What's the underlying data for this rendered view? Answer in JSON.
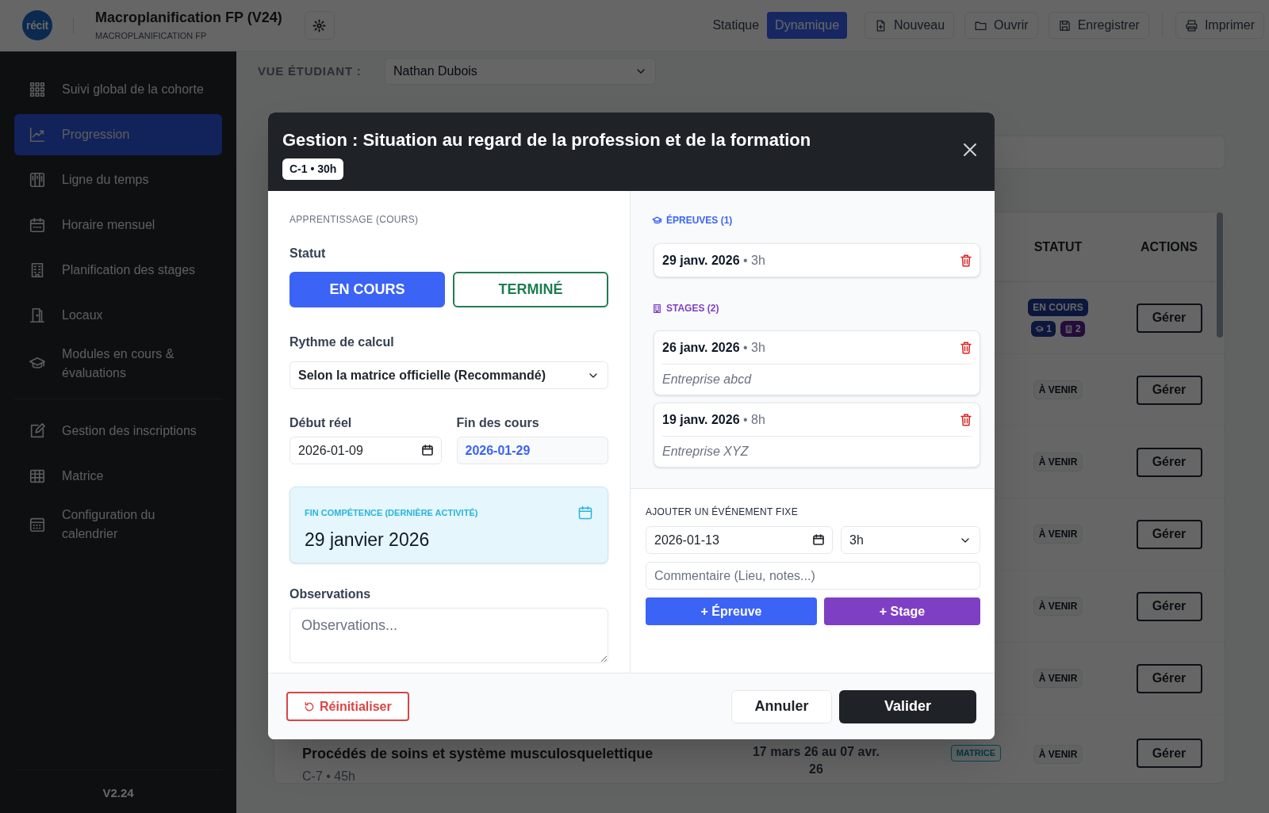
{
  "app_header": {
    "logo_text": "récit",
    "title": "Macroplanification FP (V24)",
    "subtitle": "MACROPLANIFICATION FP",
    "view_modes": [
      {
        "label": "Statique",
        "selected": false
      },
      {
        "label": "Dynamique",
        "selected": true
      }
    ],
    "actions": [
      {
        "label": "Nouveau",
        "kind": "new"
      },
      {
        "label": "Ouvrir",
        "kind": "open"
      },
      {
        "label": "Enregistrer",
        "kind": "save"
      }
    ],
    "print_action": {
      "label": "Imprimer",
      "kind": "print"
    }
  },
  "sidebar": {
    "sections": [
      {
        "items": [
          {
            "label": "Suivi global de la cohorte",
            "kind": "grid",
            "selected": false
          },
          {
            "label": "Progression",
            "kind": "chart",
            "selected": true
          },
          {
            "label": "Ligne du temps",
            "kind": "timeline",
            "selected": false
          },
          {
            "label": "Horaire mensuel",
            "kind": "calendar",
            "selected": false
          },
          {
            "label": "Planification des stages",
            "kind": "building",
            "selected": false
          },
          {
            "label": "Locaux",
            "kind": "door",
            "selected": false
          },
          {
            "label": "Modules en cours & évaluations",
            "kind": "cap",
            "selected": false
          }
        ]
      },
      {
        "items": [
          {
            "label": "Gestion des inscriptions",
            "kind": "edit",
            "selected": false
          },
          {
            "label": "Matrice",
            "kind": "table",
            "selected": false
          },
          {
            "label": "Configuration du calendrier",
            "kind": "calgrid",
            "selected": false
          }
        ]
      }
    ],
    "version": "V2.24"
  },
  "student_view": {
    "label": "VUE ÉTUDIANT :",
    "value": "Nathan Dubois"
  },
  "table": {
    "columns": [
      {
        "label": "STATUT"
      },
      {
        "label": "ACTIONS"
      }
    ],
    "rows": [
      {
        "status": "EN COURS",
        "kind": "current",
        "counts": [
          {
            "kind": "exam",
            "text": "1"
          },
          {
            "kind": "internship",
            "text": "2"
          }
        ],
        "action": "Gérer"
      },
      {
        "status": "À VENIR",
        "kind": "upcoming",
        "action": "Gérer"
      },
      {
        "status": "À VENIR",
        "kind": "upcoming",
        "action": "Gérer"
      },
      {
        "status": "À VENIR",
        "kind": "upcoming",
        "action": "Gérer"
      },
      {
        "status": "À VENIR",
        "kind": "upcoming",
        "action": "Gérer"
      },
      {
        "status": "À VENIR",
        "kind": "upcoming",
        "action": "Gérer"
      },
      {
        "title": "Procédés de soins et système musculosquelettique",
        "code": "C-7 • 45h",
        "dates": "17 mars 26 au 07 avr. 26",
        "source": "MATRICE",
        "status": "À VENIR",
        "kind": "upcoming",
        "action": "Gérer"
      }
    ]
  },
  "modal": {
    "title": "Gestion : Situation au regard de la profession et de la formation",
    "badge": "C-1 • 30h",
    "section_label": "APPRENTISSAGE (COURS)",
    "status": {
      "label": "Statut",
      "options": [
        {
          "label": "EN COURS",
          "kind": "current",
          "selected": true
        },
        {
          "label": "TERMINÉ",
          "kind": "done",
          "selected": false
        }
      ]
    },
    "rhythm": {
      "label": "Rythme de calcul",
      "value": "Selon la matrice officielle (Recommandé)"
    },
    "start": {
      "label": "Début réel",
      "value": "2026-01-09"
    },
    "end": {
      "label": "Fin des cours",
      "value": "2026-01-29"
    },
    "competence_end": {
      "label": "FIN COMPÉTENCE (DERNIÈRE ACTIVITÉ)",
      "value": "29 janvier 2026"
    },
    "observations": {
      "label": "Observations",
      "placeholder": "Observations..."
    },
    "exams": {
      "heading": "ÉPREUVES (1)",
      "items": [
        {
          "when": "**29 janv. 2026** • 3h"
        }
      ]
    },
    "internships": {
      "heading": "STAGES (2)",
      "items": [
        {
          "when": "**26 janv. 2026** • 3h",
          "note": "Entreprise abcd"
        },
        {
          "when": "**19 janv. 2026** • 8h",
          "note": "Entreprise XYZ"
        }
      ]
    },
    "add_event": {
      "heading": "AJOUTER UN ÉVÉNEMENT FIXE",
      "date": "2026-01-13",
      "duration": "3h",
      "comment_placeholder": "Commentaire (Lieu, notes...)",
      "buttons": [
        {
          "label": "+ Épreuve",
          "kind": "exam"
        },
        {
          "label": "+ Stage",
          "kind": "internship"
        }
      ]
    },
    "footer": {
      "reset": "Réinitialiser",
      "cancel": "Annuler",
      "confirm": "Valider"
    }
  }
}
